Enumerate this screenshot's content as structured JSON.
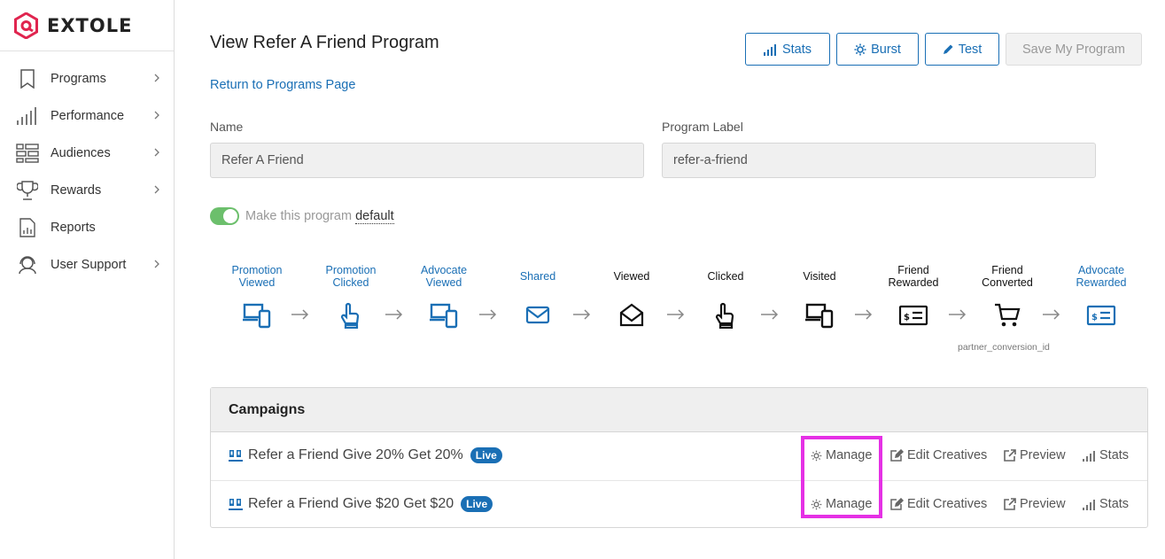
{
  "brand": {
    "name": "EXTOLE",
    "accent": "#e0254f"
  },
  "sidebar": {
    "items": [
      {
        "label": "Programs",
        "icon": "bookmark-icon",
        "chevron": true
      },
      {
        "label": "Performance",
        "icon": "bar-chart-icon",
        "chevron": true
      },
      {
        "label": "Audiences",
        "icon": "audience-list-icon",
        "chevron": true
      },
      {
        "label": "Rewards",
        "icon": "trophy-icon",
        "chevron": true
      },
      {
        "label": "Reports",
        "icon": "report-document-icon",
        "chevron": false
      },
      {
        "label": "User Support",
        "icon": "support-headset-icon",
        "chevron": true
      }
    ]
  },
  "header": {
    "title": "View Refer A Friend Program",
    "return_link": "Return to Programs Page",
    "buttons": {
      "stats": "Stats",
      "burst": "Burst",
      "test": "Test",
      "save": "Save My Program"
    }
  },
  "form": {
    "name_label": "Name",
    "name_value": "Refer A Friend",
    "program_label_label": "Program Label",
    "program_label_value": "refer-a-friend",
    "default_toggle_text": "Make this program",
    "default_toggle_link": "default",
    "default_toggle_on": true
  },
  "flow": {
    "steps": [
      {
        "line1": "Promotion",
        "line2": "Viewed",
        "icon": "devices-icon",
        "color": "#1a6fb5"
      },
      {
        "line1": "Promotion",
        "line2": "Clicked",
        "icon": "hand-click-icon",
        "color": "#1a6fb5"
      },
      {
        "line1": "Advocate",
        "line2": "Viewed",
        "icon": "devices-icon",
        "color": "#1a6fb5"
      },
      {
        "line1": "Shared",
        "line2": "",
        "icon": "envelope-icon",
        "color": "#1a6fb5"
      },
      {
        "line1": "Viewed",
        "line2": "",
        "icon": "envelope-open-icon",
        "color": "#111111"
      },
      {
        "line1": "Clicked",
        "line2": "",
        "icon": "hand-click-icon",
        "color": "#111111"
      },
      {
        "line1": "Visited",
        "line2": "",
        "icon": "devices-icon",
        "color": "#111111"
      },
      {
        "line1": "Friend",
        "line2": "Rewarded",
        "icon": "reward-card-icon",
        "color": "#111111"
      },
      {
        "line1": "Friend",
        "line2": "Converted",
        "icon": "shopping-cart-icon",
        "color": "#111111"
      },
      {
        "line1": "Advocate",
        "line2": "Rewarded",
        "icon": "reward-card-icon",
        "color": "#1a6fb5"
      }
    ],
    "conversion_note": "partner_conversion_id"
  },
  "campaigns": {
    "header": "Campaigns",
    "rows": [
      {
        "name": "Refer a Friend Give 20% Get 20%",
        "status": "Live"
      },
      {
        "name": "Refer a Friend Give $20 Get $20",
        "status": "Live"
      }
    ],
    "actions": {
      "manage": "Manage",
      "edit": "Edit Creatives",
      "preview": "Preview",
      "stats": "Stats"
    }
  },
  "colors": {
    "link": "#1a6fb5",
    "highlight": "#e530e5",
    "toggle_on": "#6cbf6c"
  }
}
